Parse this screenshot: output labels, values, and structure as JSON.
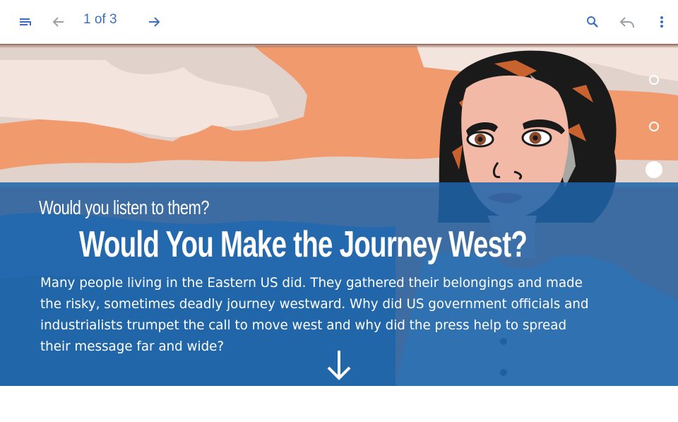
{
  "toolbar": {
    "page_indicator": "1 of 3",
    "icons": [
      "list-menu-icon",
      "arrow-left-icon",
      "arrow-right-icon",
      "search-icon",
      "reply-icon",
      "more-vert-icon"
    ]
  },
  "hero": {
    "subtitle": "Would you listen to them?",
    "title": "Would You Make the Journey West?",
    "body": "Many people living in the Eastern US did. They gathered their belongings and made the risky, sometimes deadly journey westward. Why did US government officials and industrialists trumpet the call to move west and why did the press help to spread their message far and wide?"
  },
  "colors": {
    "accent": "#3a6fc4",
    "sky": "#f19a6e",
    "overlay_blue": "#1e64aa"
  }
}
